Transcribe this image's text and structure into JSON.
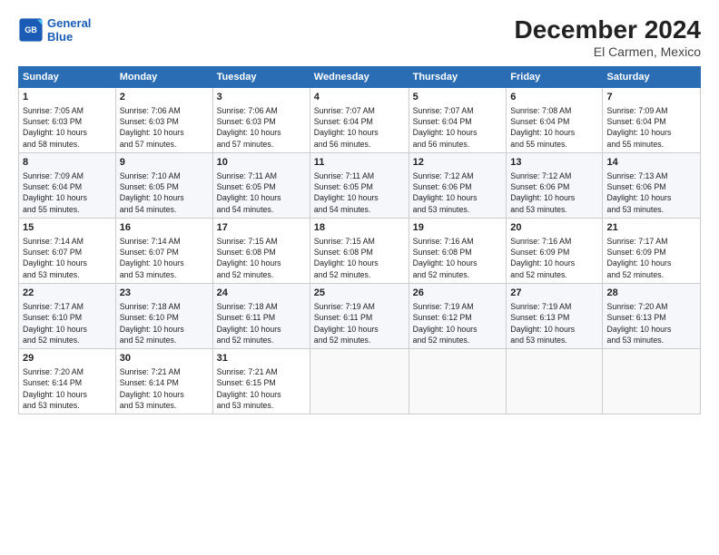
{
  "logo": {
    "line1": "General",
    "line2": "Blue"
  },
  "title": "December 2024",
  "subtitle": "El Carmen, Mexico",
  "days_header": [
    "Sunday",
    "Monday",
    "Tuesday",
    "Wednesday",
    "Thursday",
    "Friday",
    "Saturday"
  ],
  "weeks": [
    [
      {
        "day": "1",
        "info": "Sunrise: 7:05 AM\nSunset: 6:03 PM\nDaylight: 10 hours\nand 58 minutes."
      },
      {
        "day": "2",
        "info": "Sunrise: 7:06 AM\nSunset: 6:03 PM\nDaylight: 10 hours\nand 57 minutes."
      },
      {
        "day": "3",
        "info": "Sunrise: 7:06 AM\nSunset: 6:03 PM\nDaylight: 10 hours\nand 57 minutes."
      },
      {
        "day": "4",
        "info": "Sunrise: 7:07 AM\nSunset: 6:04 PM\nDaylight: 10 hours\nand 56 minutes."
      },
      {
        "day": "5",
        "info": "Sunrise: 7:07 AM\nSunset: 6:04 PM\nDaylight: 10 hours\nand 56 minutes."
      },
      {
        "day": "6",
        "info": "Sunrise: 7:08 AM\nSunset: 6:04 PM\nDaylight: 10 hours\nand 55 minutes."
      },
      {
        "day": "7",
        "info": "Sunrise: 7:09 AM\nSunset: 6:04 PM\nDaylight: 10 hours\nand 55 minutes."
      }
    ],
    [
      {
        "day": "8",
        "info": "Sunrise: 7:09 AM\nSunset: 6:04 PM\nDaylight: 10 hours\nand 55 minutes."
      },
      {
        "day": "9",
        "info": "Sunrise: 7:10 AM\nSunset: 6:05 PM\nDaylight: 10 hours\nand 54 minutes."
      },
      {
        "day": "10",
        "info": "Sunrise: 7:11 AM\nSunset: 6:05 PM\nDaylight: 10 hours\nand 54 minutes."
      },
      {
        "day": "11",
        "info": "Sunrise: 7:11 AM\nSunset: 6:05 PM\nDaylight: 10 hours\nand 54 minutes."
      },
      {
        "day": "12",
        "info": "Sunrise: 7:12 AM\nSunset: 6:06 PM\nDaylight: 10 hours\nand 53 minutes."
      },
      {
        "day": "13",
        "info": "Sunrise: 7:12 AM\nSunset: 6:06 PM\nDaylight: 10 hours\nand 53 minutes."
      },
      {
        "day": "14",
        "info": "Sunrise: 7:13 AM\nSunset: 6:06 PM\nDaylight: 10 hours\nand 53 minutes."
      }
    ],
    [
      {
        "day": "15",
        "info": "Sunrise: 7:14 AM\nSunset: 6:07 PM\nDaylight: 10 hours\nand 53 minutes."
      },
      {
        "day": "16",
        "info": "Sunrise: 7:14 AM\nSunset: 6:07 PM\nDaylight: 10 hours\nand 53 minutes."
      },
      {
        "day": "17",
        "info": "Sunrise: 7:15 AM\nSunset: 6:08 PM\nDaylight: 10 hours\nand 52 minutes."
      },
      {
        "day": "18",
        "info": "Sunrise: 7:15 AM\nSunset: 6:08 PM\nDaylight: 10 hours\nand 52 minutes."
      },
      {
        "day": "19",
        "info": "Sunrise: 7:16 AM\nSunset: 6:08 PM\nDaylight: 10 hours\nand 52 minutes."
      },
      {
        "day": "20",
        "info": "Sunrise: 7:16 AM\nSunset: 6:09 PM\nDaylight: 10 hours\nand 52 minutes."
      },
      {
        "day": "21",
        "info": "Sunrise: 7:17 AM\nSunset: 6:09 PM\nDaylight: 10 hours\nand 52 minutes."
      }
    ],
    [
      {
        "day": "22",
        "info": "Sunrise: 7:17 AM\nSunset: 6:10 PM\nDaylight: 10 hours\nand 52 minutes."
      },
      {
        "day": "23",
        "info": "Sunrise: 7:18 AM\nSunset: 6:10 PM\nDaylight: 10 hours\nand 52 minutes."
      },
      {
        "day": "24",
        "info": "Sunrise: 7:18 AM\nSunset: 6:11 PM\nDaylight: 10 hours\nand 52 minutes."
      },
      {
        "day": "25",
        "info": "Sunrise: 7:19 AM\nSunset: 6:11 PM\nDaylight: 10 hours\nand 52 minutes."
      },
      {
        "day": "26",
        "info": "Sunrise: 7:19 AM\nSunset: 6:12 PM\nDaylight: 10 hours\nand 52 minutes."
      },
      {
        "day": "27",
        "info": "Sunrise: 7:19 AM\nSunset: 6:13 PM\nDaylight: 10 hours\nand 53 minutes."
      },
      {
        "day": "28",
        "info": "Sunrise: 7:20 AM\nSunset: 6:13 PM\nDaylight: 10 hours\nand 53 minutes."
      }
    ],
    [
      {
        "day": "29",
        "info": "Sunrise: 7:20 AM\nSunset: 6:14 PM\nDaylight: 10 hours\nand 53 minutes."
      },
      {
        "day": "30",
        "info": "Sunrise: 7:21 AM\nSunset: 6:14 PM\nDaylight: 10 hours\nand 53 minutes."
      },
      {
        "day": "31",
        "info": "Sunrise: 7:21 AM\nSunset: 6:15 PM\nDaylight: 10 hours\nand 53 minutes."
      },
      {
        "day": "",
        "info": ""
      },
      {
        "day": "",
        "info": ""
      },
      {
        "day": "",
        "info": ""
      },
      {
        "day": "",
        "info": ""
      }
    ]
  ]
}
